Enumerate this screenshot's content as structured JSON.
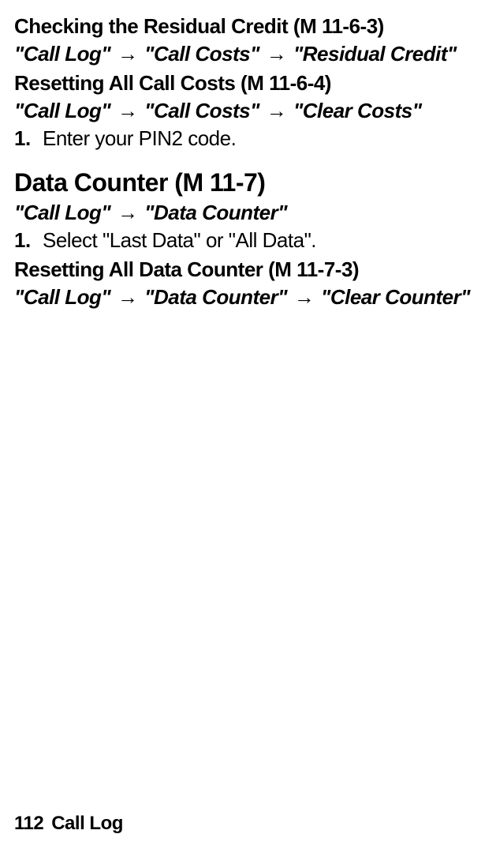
{
  "section1": {
    "heading": "Checking the Residual Credit ",
    "menucode": "(M 11-6-3)",
    "path_parts": [
      "\"Call Log\"",
      "\"Call Costs\"",
      "\"Residual Credit\""
    ]
  },
  "section2": {
    "heading": "Resetting All Call Costs ",
    "menucode": "(M 11-6-4)",
    "path_parts": [
      "\"Call Log\"",
      "\"Call Costs\"",
      "\"Clear Costs\""
    ],
    "step_num": "1.",
    "step_text": "Enter your PIN2 code."
  },
  "section3": {
    "heading": "Data Counter ",
    "menucode": "(M 11-7)",
    "path_parts": [
      "\"Call Log\"",
      "\"Data Counter\""
    ],
    "step_num": "1.",
    "step_text": "Select \"Last Data\" or \"All Data\"."
  },
  "section4": {
    "heading": "Resetting All Data Counter ",
    "menucode": "(M 11-7-3)",
    "path_parts": [
      "\"Call Log\"",
      "\"Data Counter\"",
      "\"Clear Counter\""
    ]
  },
  "footer": {
    "page": "112",
    "title": "Call Log"
  },
  "arrow": " → "
}
